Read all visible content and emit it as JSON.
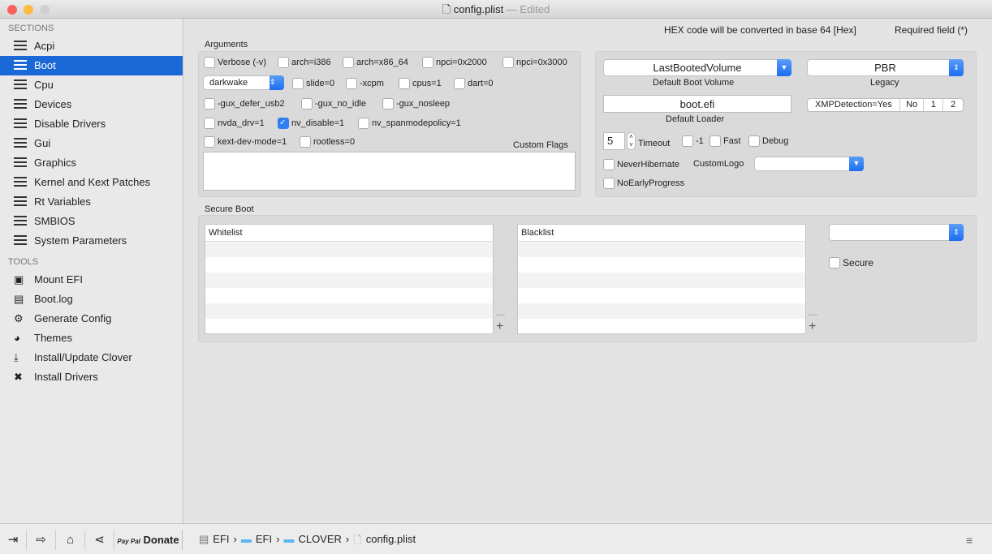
{
  "window": {
    "title": "config.plist",
    "edited": "— Edited"
  },
  "sidebar": {
    "sections_header": "SECTIONS",
    "sections": [
      "Acpi",
      "Boot",
      "Cpu",
      "Devices",
      "Disable Drivers",
      "Gui",
      "Graphics",
      "Kernel and Kext Patches",
      "Rt Variables",
      "SMBIOS",
      "System Parameters"
    ],
    "selected": "Boot",
    "tools_header": "TOOLS",
    "tools": [
      {
        "label": "Mount EFI",
        "icon": "disk-icon"
      },
      {
        "label": "Boot.log",
        "icon": "log-icon"
      },
      {
        "label": "Generate Config",
        "icon": "gears-icon"
      },
      {
        "label": "Themes",
        "icon": "palette-icon"
      },
      {
        "label": "Install/Update Clover",
        "icon": "download-icon"
      },
      {
        "label": "Install Drivers",
        "icon": "tools-icon"
      }
    ]
  },
  "header": {
    "hex_note": "HEX code will be converted in base 64 [Hex]",
    "required": "Required field (*)"
  },
  "arguments": {
    "title": "Arguments",
    "row1": [
      {
        "label": "Verbose (-v)",
        "checked": false
      },
      {
        "label": "arch=i386",
        "checked": false
      },
      {
        "label": "arch=x86_64",
        "checked": false
      },
      {
        "label": "npci=0x2000",
        "checked": false
      },
      {
        "label": "npci=0x3000",
        "checked": false
      }
    ],
    "popup_value": "darkwake",
    "row2": [
      {
        "label": "slide=0",
        "checked": false
      },
      {
        "label": "-xcpm",
        "checked": false
      },
      {
        "label": "cpus=1",
        "checked": false
      },
      {
        "label": "dart=0",
        "checked": false
      }
    ],
    "row3": [
      {
        "label": "-gux_defer_usb2",
        "checked": false
      },
      {
        "label": "-gux_no_idle",
        "checked": false
      },
      {
        "label": "-gux_nosleep",
        "checked": false
      }
    ],
    "row4": [
      {
        "label": "nvda_drv=1",
        "checked": false
      },
      {
        "label": "nv_disable=1",
        "checked": true
      },
      {
        "label": "nv_spanmodepolicy=1",
        "checked": false
      }
    ],
    "row5": [
      {
        "label": "kext-dev-mode=1",
        "checked": false
      },
      {
        "label": "rootless=0",
        "checked": false
      }
    ],
    "custom_flags_label": "Custom Flags",
    "custom_flags_value": ""
  },
  "boot": {
    "default_volume": "LastBootedVolume",
    "default_volume_label": "Default Boot Volume",
    "legacy": "PBR",
    "legacy_label": "Legacy",
    "loader": "boot.efi",
    "loader_label": "Default Loader",
    "xmp": [
      "XMPDetection=Yes",
      "No",
      "1",
      "2"
    ],
    "timeout": "5",
    "timeout_label": "Timeout",
    "minus1": "-1",
    "fast": "Fast",
    "debug": "Debug",
    "never_hibernate": "NeverHibernate",
    "custom_logo_label": "CustomLogo",
    "custom_logo": "",
    "no_early_progress": "NoEarlyProgress"
  },
  "secure_boot": {
    "title": "Secure Boot",
    "whitelist": "Whitelist",
    "blacklist": "Blacklist",
    "policy": "",
    "secure": "Secure",
    "minus": "—",
    "plus": "+"
  },
  "bottom": {
    "donate": "Donate",
    "paypal": "Pay Pal",
    "path": [
      "EFI",
      "EFI",
      "CLOVER",
      "config.plist"
    ],
    "sep": "›"
  },
  "colors": {
    "accent": "#1a69d7"
  }
}
